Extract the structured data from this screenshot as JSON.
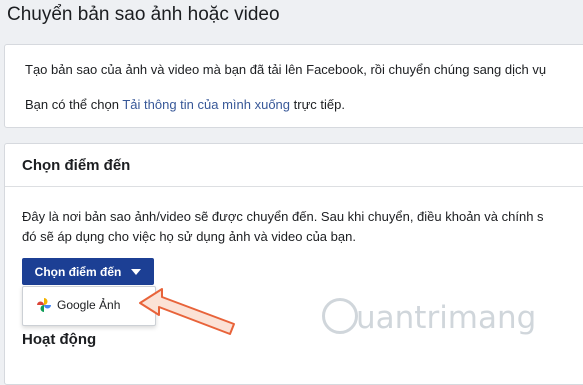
{
  "page": {
    "title": "Chuyển bản sao ảnh hoặc video"
  },
  "intro": {
    "text": "Tạo bản sao của ảnh và video mà bạn đã tải lên Facebook, rồi chuyển chúng sang dịch vụ",
    "link_prefix": "Bạn có thể chọn ",
    "link_text": "Tải thông tin của mình xuống",
    "link_suffix": " trực tiếp."
  },
  "destination": {
    "heading": "Chọn điểm đến",
    "description_line1": "Đây là nơi bản sao ảnh/video sẽ được chuyển đến. Sau khi chuyển, điều khoản và chính s",
    "description_line2": "đó sẽ áp dụng cho việc họ sử dụng ảnh và video của bạn.",
    "button_label": "Chọn điểm đến",
    "dropdown_items": [
      {
        "label": "Google Ảnh",
        "icon": "google-photos-icon"
      }
    ]
  },
  "activity": {
    "heading": "Hoạt động"
  },
  "watermark": {
    "text": "uantrimang"
  },
  "colors": {
    "button": "#1c3f94",
    "link": "#385898",
    "arrow": "#e8633a"
  }
}
